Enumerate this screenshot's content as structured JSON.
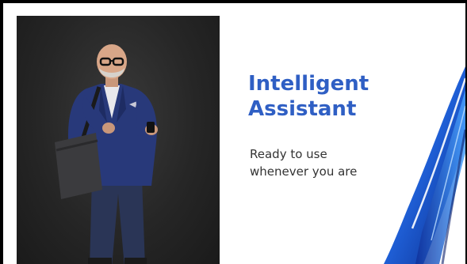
{
  "slide": {
    "title_line1": "Intelligent",
    "title_line2": "Assistant",
    "subtitle_line1": "Ready to use",
    "subtitle_line2": "whenever you are",
    "photo_icon": "businessman-photo",
    "ribbon_icon": "blue-wave-ribbon"
  },
  "colors": {
    "title": "#2f5fc4",
    "subtitle": "#333333",
    "background": "#ffffff",
    "frame": "#000000"
  }
}
